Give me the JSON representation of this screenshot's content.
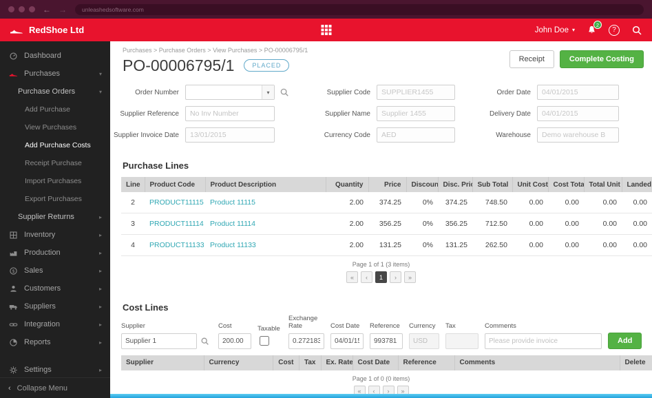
{
  "browser": {
    "url": "unleashedsoftware.com"
  },
  "header": {
    "brand": "RedShoe Ltd",
    "user_menu": "John Doe",
    "notification_count": "2"
  },
  "icons": {
    "chevron_down": "▾",
    "chevron_right": "▸",
    "collapse_chevron": "‹",
    "dropdown_caret": "▾",
    "user_caret": "▾",
    "help_glyph": "?",
    "pager_first": "«",
    "pager_prev": "‹",
    "pager_next": "›",
    "pager_last": "»"
  },
  "sidebar": {
    "items": [
      {
        "label": "Dashboard"
      },
      {
        "label": "Purchases"
      },
      {
        "label": "Purchase Orders"
      },
      {
        "label": "Add Purchase"
      },
      {
        "label": "View Purchases"
      },
      {
        "label": "Add Purchase Costs"
      },
      {
        "label": "Receipt Purchase"
      },
      {
        "label": "Import Purchases"
      },
      {
        "label": "Export Purchases"
      },
      {
        "label": "Supplier Returns"
      },
      {
        "label": "Inventory"
      },
      {
        "label": "Production"
      },
      {
        "label": "Sales"
      },
      {
        "label": "Customers"
      },
      {
        "label": "Suppliers"
      },
      {
        "label": "Integration"
      },
      {
        "label": "Reports"
      },
      {
        "label": "Settings"
      }
    ],
    "collapse_label": "Collapse Menu"
  },
  "page": {
    "breadcrumb": "Purchases > Purchase Orders > View Purchases > PO-00006795/1",
    "title": "PO-00006795/1",
    "status_badge": "PLACED",
    "receipt_button": "Receipt",
    "complete_costing_button": "Complete Costing"
  },
  "order_form": {
    "order_number_label": "Order Number",
    "order_number_value": "",
    "supplier_reference_label": "Supplier Reference",
    "supplier_reference_placeholder": "No Inv Number",
    "supplier_invoice_date_label": "Supplier Invoice Date",
    "supplier_invoice_date_value": "13/01/2015",
    "supplier_code_label": "Supplier Code",
    "supplier_code_value": "SUPPLIER1455",
    "supplier_name_label": "Supplier Name",
    "supplier_name_value": "Supplier 1455",
    "currency_code_label": "Currency Code",
    "currency_code_value": "AED",
    "order_date_label": "Order Date",
    "order_date_value": "04/01/2015",
    "delivery_date_label": "Delivery Date",
    "delivery_date_value": "04/01/2015",
    "warehouse_label": "Warehouse",
    "warehouse_value": "Demo warehouse B"
  },
  "purchase_lines": {
    "title": "Purchase Lines",
    "headers": [
      "Line",
      "Product Code",
      "Product Description",
      "Quantity",
      "Price",
      "Discount",
      "Disc. Pric",
      "Sub Total",
      "Unit Cost",
      "Cost Total",
      "Total Unit C",
      "Landed Cos"
    ],
    "rows": [
      {
        "line": "2",
        "product_code": "PRODUCT11115",
        "description": "Product 11115",
        "quantity": "2.00",
        "price": "374.25",
        "discount": "0%",
        "disc_price": "374.25",
        "sub_total": "748.50",
        "unit_cost": "0.00",
        "cost_total": "0.00",
        "total_unit_cost": "0.00",
        "landed_cost": "0.00"
      },
      {
        "line": "3",
        "product_code": "PRODUCT11114",
        "description": "Product 11114",
        "quantity": "2.00",
        "price": "356.25",
        "discount": "0%",
        "disc_price": "356.25",
        "sub_total": "712.50",
        "unit_cost": "0.00",
        "cost_total": "0.00",
        "total_unit_cost": "0.00",
        "landed_cost": "0.00"
      },
      {
        "line": "4",
        "product_code": "PRODUCT11133",
        "description": "Product 11133",
        "quantity": "2.00",
        "price": "131.25",
        "discount": "0%",
        "disc_price": "131.25",
        "sub_total": "262.50",
        "unit_cost": "0.00",
        "cost_total": "0.00",
        "total_unit_cost": "0.00",
        "landed_cost": "0.00"
      }
    ],
    "pager": {
      "summary": "Page 1 of 1 (3 items)",
      "page": "1"
    }
  },
  "cost_lines": {
    "title": "Cost Lines",
    "supplier_label": "Supplier",
    "supplier_value": "Supplier 1",
    "cost_label": "Cost",
    "cost_value": "200.00",
    "taxable_label": "Taxable",
    "exchange_rate_label": "Exchange Rate",
    "exchange_rate_value": "0.272183",
    "cost_date_label": "Cost Date",
    "cost_date_value": "04/01/15",
    "reference_label": "Reference",
    "reference_value": "993781",
    "currency_label": "Currency",
    "currency_value": "USD",
    "tax_label": "Tax",
    "tax_value": "",
    "comments_label": "Comments",
    "comments_placeholder": "Please provide invoice",
    "add_button": "Add",
    "headers": [
      "Supplier",
      "Currency",
      "Cost",
      "Tax",
      "Ex. Rate",
      "Cost Date",
      "Reference",
      "Comments",
      "Delete"
    ],
    "pager": {
      "summary": "Page 1 of 0 (0 items)"
    }
  }
}
